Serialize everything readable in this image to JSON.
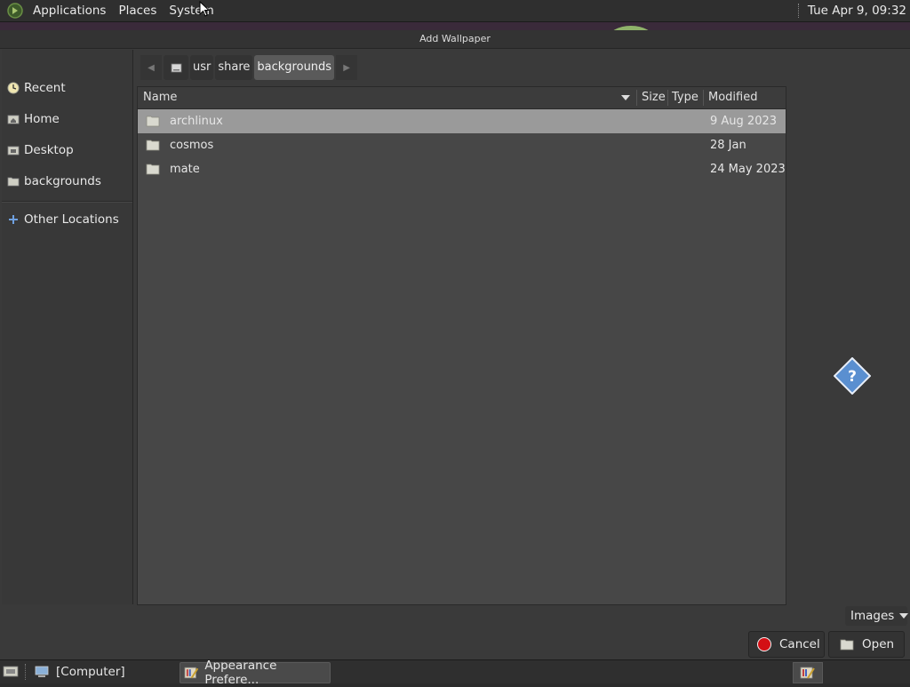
{
  "top_panel": {
    "menus": [
      "Applications",
      "Places",
      "System"
    ],
    "clock": "Tue Apr  9, 09:32"
  },
  "dialog": {
    "title": "Add Wallpaper",
    "sidebar": {
      "items": [
        {
          "label": "Recent",
          "icon": "clock-icon"
        },
        {
          "label": "Home",
          "icon": "home-folder-icon"
        },
        {
          "label": "Desktop",
          "icon": "desktop-folder-icon"
        },
        {
          "label": "backgrounds",
          "icon": "folder-icon"
        }
      ],
      "other_locations": {
        "label": "Other Locations",
        "icon": "plus-icon"
      }
    },
    "path": {
      "crumbs": [
        "usr",
        "share",
        "backgrounds"
      ],
      "active": "backgrounds"
    },
    "columns": {
      "name": "Name",
      "size": "Size",
      "type": "Type",
      "modified": "Modified"
    },
    "files": [
      {
        "name": "archlinux",
        "modified": "9 Aug 2023",
        "selected": true
      },
      {
        "name": "cosmos",
        "modified": "28 Jan",
        "selected": false
      },
      {
        "name": "mate",
        "modified": "24 May 2023",
        "selected": false
      }
    ],
    "filter": "Images",
    "cancel_label": "Cancel",
    "open_label": "Open"
  },
  "taskbar": {
    "tasks": [
      "[Computer]",
      "Appearance Prefere..."
    ]
  },
  "colors": {
    "selection": "#9a9a9a",
    "cancel_red": "#d30f15",
    "help_blue": "#5a8fd0"
  }
}
